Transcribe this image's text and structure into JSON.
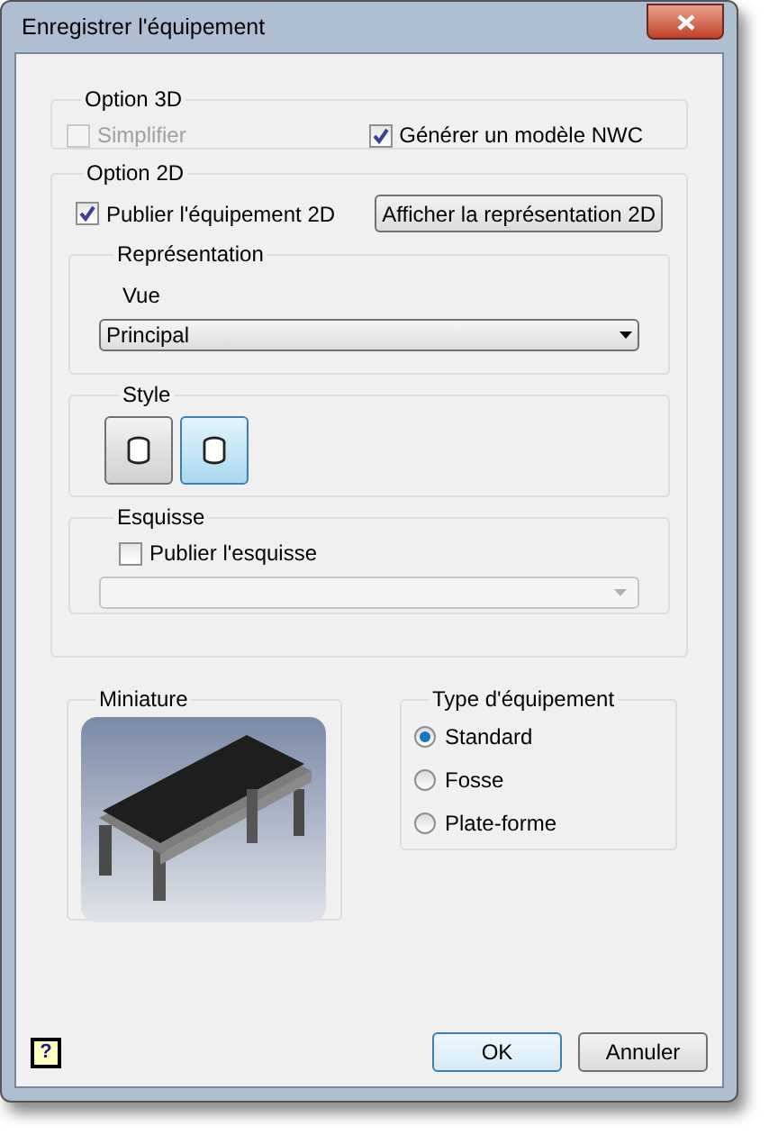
{
  "window": {
    "title": "Enregistrer l'équipement"
  },
  "option_3d": {
    "title": "Option 3D",
    "checkboxes": [
      {
        "label": "Simplifier",
        "checked": false,
        "disabled": true
      },
      {
        "label": "Générer un modèle NWC",
        "checked": true,
        "disabled": false
      }
    ]
  },
  "option_2d": {
    "title": "Option 2D",
    "publish": {
      "label": "Publier l'équipement 2D",
      "checked": true,
      "disabled": false
    },
    "show_button": "Afficher la représentation 2D",
    "representation": {
      "title": "Représentation",
      "view_label": "Vue",
      "view_value": "Principal"
    },
    "style": {
      "title": "Style",
      "buttons": [
        {
          "selected": false
        },
        {
          "selected": true
        }
      ]
    },
    "sketch": {
      "title": "Esquisse",
      "publish": {
        "label": "Publier l'esquisse",
        "checked": false,
        "disabled": false
      },
      "dropdown_disabled": true
    }
  },
  "thumbnail": {
    "title": "Miniature",
    "kind": "picture"
  },
  "equipment_type": {
    "title": "Type d'équipement",
    "options": [
      {
        "label": "Standard",
        "selected": true
      },
      {
        "label": "Fosse",
        "selected": false
      },
      {
        "label": "Plate-forme",
        "selected": false
      }
    ]
  },
  "help": "?",
  "buttons": [
    {
      "label": "OK",
      "default": true
    },
    {
      "label": "Annuler",
      "default": false
    }
  ]
}
